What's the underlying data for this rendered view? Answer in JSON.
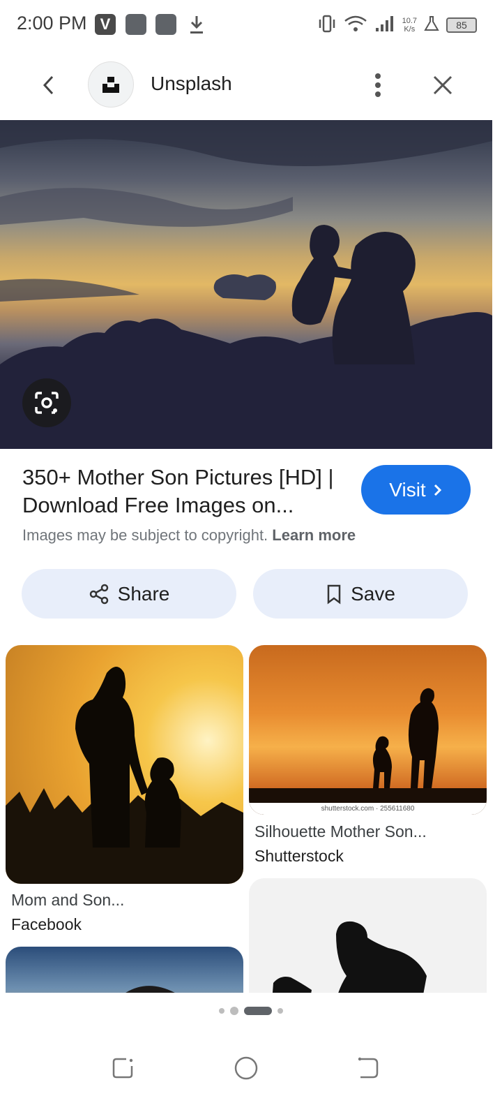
{
  "status_bar": {
    "time": "2:00 PM",
    "app_icon_v": "V",
    "net_speed_value": "10.7",
    "net_speed_unit": "K/s",
    "battery": "85",
    "icons": [
      "vibrate-icon",
      "wifi-icon",
      "signal-icon",
      "flask-icon",
      "download-icon"
    ]
  },
  "header": {
    "site_name": "Unsplash",
    "icons": [
      "back-arrow-icon",
      "unsplash-logo",
      "more-vert-icon",
      "close-icon"
    ]
  },
  "result": {
    "title": "350+ Mother Son Pictures [HD] | Download Free Images on...",
    "visit_label": "Visit",
    "copyright_text": "Images may be subject to copyright.",
    "learn_more": "Learn more"
  },
  "actions": {
    "share_label": "Share",
    "save_label": "Save"
  },
  "related": [
    {
      "title": "Mom and Son...",
      "source": "Facebook"
    },
    {
      "title": "Silhouette Mother Son...",
      "source": "Shutterstock",
      "watermark": "shutterstock.com · 255611680"
    }
  ],
  "colors": {
    "accent": "#1a73e8",
    "pill_bg": "#e8eefa"
  }
}
